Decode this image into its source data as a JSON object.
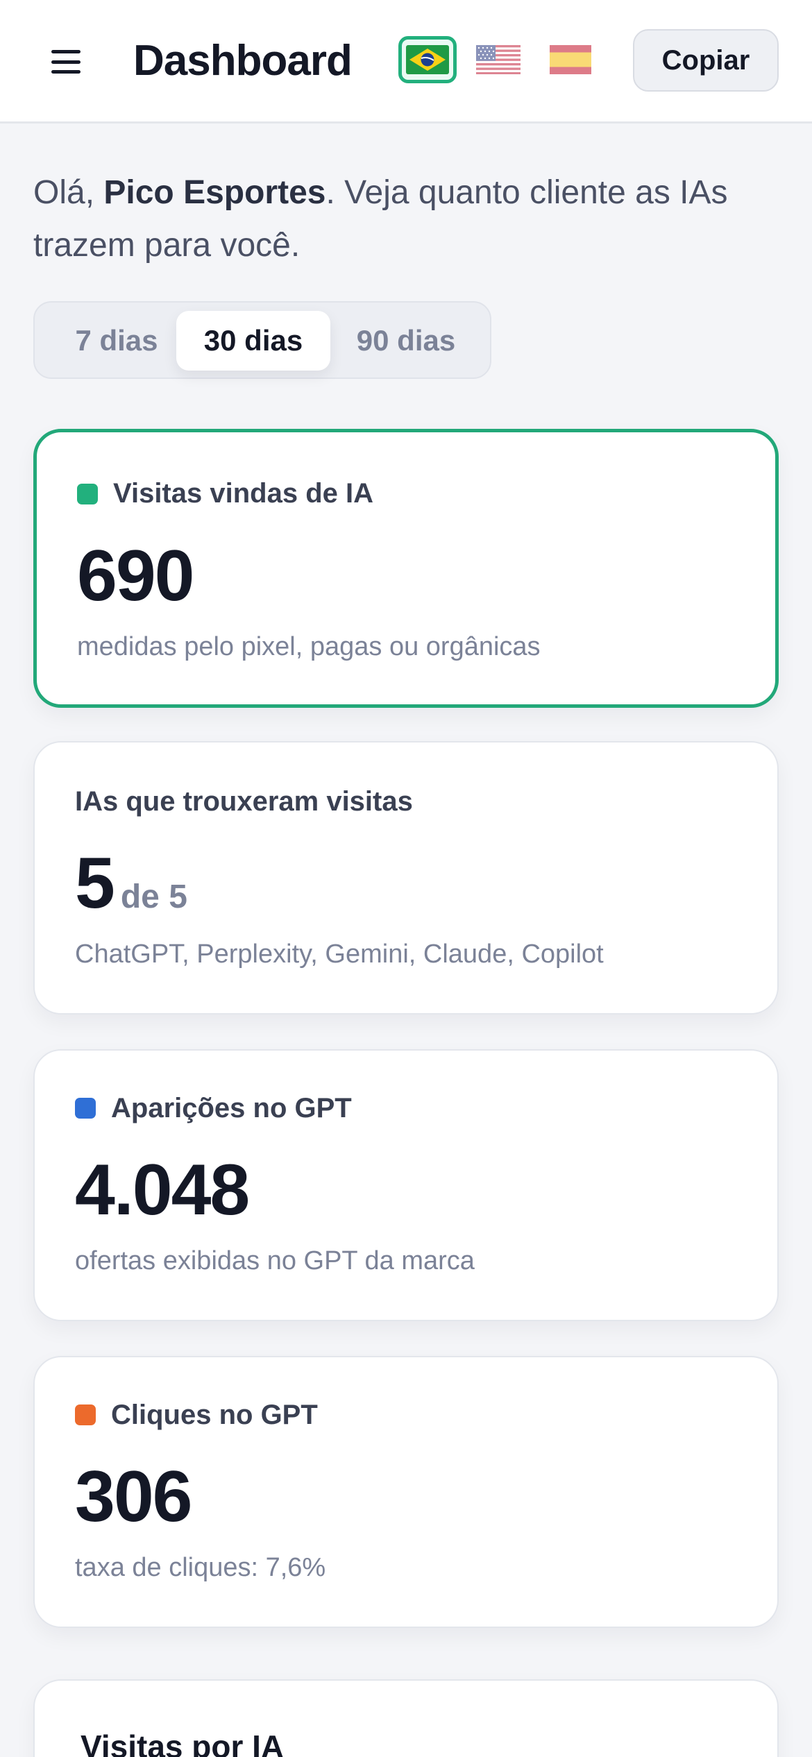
{
  "header": {
    "title": "Dashboard",
    "menu_icon": "hamburger-menu-icon",
    "languages": [
      {
        "code": "pt-BR",
        "icon": "brazil-flag-icon",
        "active": true
      },
      {
        "code": "en-US",
        "icon": "usa-flag-icon",
        "active": false
      },
      {
        "code": "es",
        "icon": "spain-flag-icon",
        "active": false
      }
    ],
    "copy_label": "Copiar"
  },
  "greeting": {
    "prefix": "Olá, ",
    "name": "Pico Esportes",
    "suffix": ". Veja quanto cliente as IAs trazem para você."
  },
  "range_tabs": {
    "items": [
      "7 dias",
      "30 dias",
      "90 dias"
    ],
    "selected": "30 dias"
  },
  "cards": [
    {
      "label": "Visitas vindas de IA",
      "value": "690",
      "note": "medidas pelo pixel, pagas ou orgânicas",
      "dot_color": "#22b07d",
      "highlighted": true
    },
    {
      "label": "IAs que trouxeram visitas",
      "value": "5",
      "suffix": "de 5",
      "note": "ChatGPT, Perplexity, Gemini, Claude, Copilot"
    },
    {
      "label": "Aparições no GPT",
      "value": "4.048",
      "note": "ofertas exibidas no GPT da marca",
      "dot_color": "#2f6fd6"
    },
    {
      "label": "Cliques no GPT",
      "value": "306",
      "note": "taxa de cliques: 7,6%",
      "dot_color": "#ec6a2c"
    },
    {
      "label": "Visitas por IA"
    }
  ],
  "colors": {
    "accent_green": "#22a879",
    "blue": "#2f6fd6",
    "orange": "#ec6a2c",
    "background": "#f4f5f8"
  }
}
